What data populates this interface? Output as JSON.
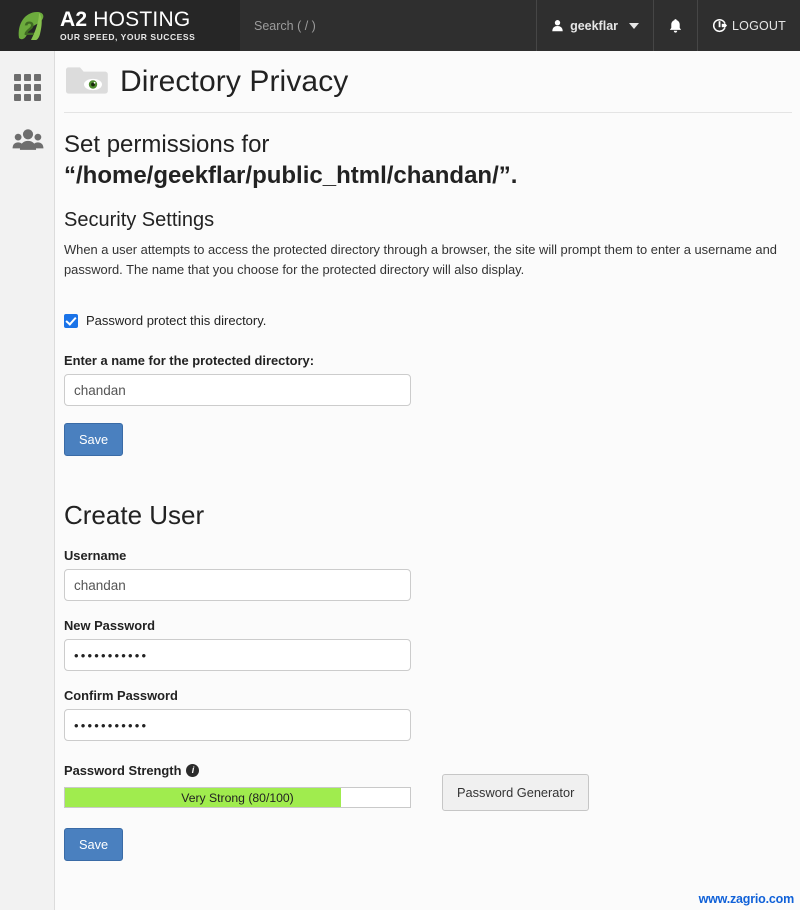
{
  "topbar": {
    "logo": {
      "name_bold": "A2",
      "name_rest": " HOSTING",
      "tagline": "OUR SPEED, YOUR SUCCESS",
      "mark_icon": "a2-leaf-logo-icon",
      "brand_green": "#6cab3d"
    },
    "search_placeholder": "Search ( / )",
    "user": {
      "icon": "user-icon",
      "name": "geekflar",
      "caret_icon": "chevron-down-icon"
    },
    "notifications_icon": "bell-icon",
    "logout": {
      "icon": "logout-icon",
      "label": "LOGOUT"
    },
    "background": "#2f2f2f"
  },
  "sidebar": {
    "items": [
      {
        "name": "apps-grid",
        "icon": "grid-icon"
      },
      {
        "name": "user-manager",
        "icon": "users-group-icon"
      }
    ]
  },
  "page": {
    "icon": "folder-eye-icon",
    "title": "Directory Privacy",
    "permissions_prefix": "Set permissions for",
    "permissions_path": "“/home/geekflar/public_html/chandan/”."
  },
  "security": {
    "heading": "Security Settings",
    "description": "When a user attempts to access the protected directory through a browser, the site will prompt them to enter a username and password. The name that you choose for the protected directory will also display.",
    "checkbox": {
      "label": "Password protect this directory.",
      "checked": true
    },
    "dir_name_label": "Enter a name for the protected directory:",
    "dir_name_value": "chandan",
    "save_label": "Save"
  },
  "create_user": {
    "heading": "Create User",
    "username_label": "Username",
    "username_value": "chandan",
    "new_password_label": "New Password",
    "new_password_value": "•••••••••••",
    "confirm_password_label": "Confirm Password",
    "confirm_password_value": "•••••••••••",
    "strength_label": "Password Strength",
    "strength_info_icon": "info-icon",
    "strength_text": "Very Strong (80/100)",
    "strength_percent": 80,
    "strength_color": "#a0ec4e",
    "generator_label": "Password Generator",
    "save_label": "Save"
  },
  "watermark": "www.zagrio.com"
}
